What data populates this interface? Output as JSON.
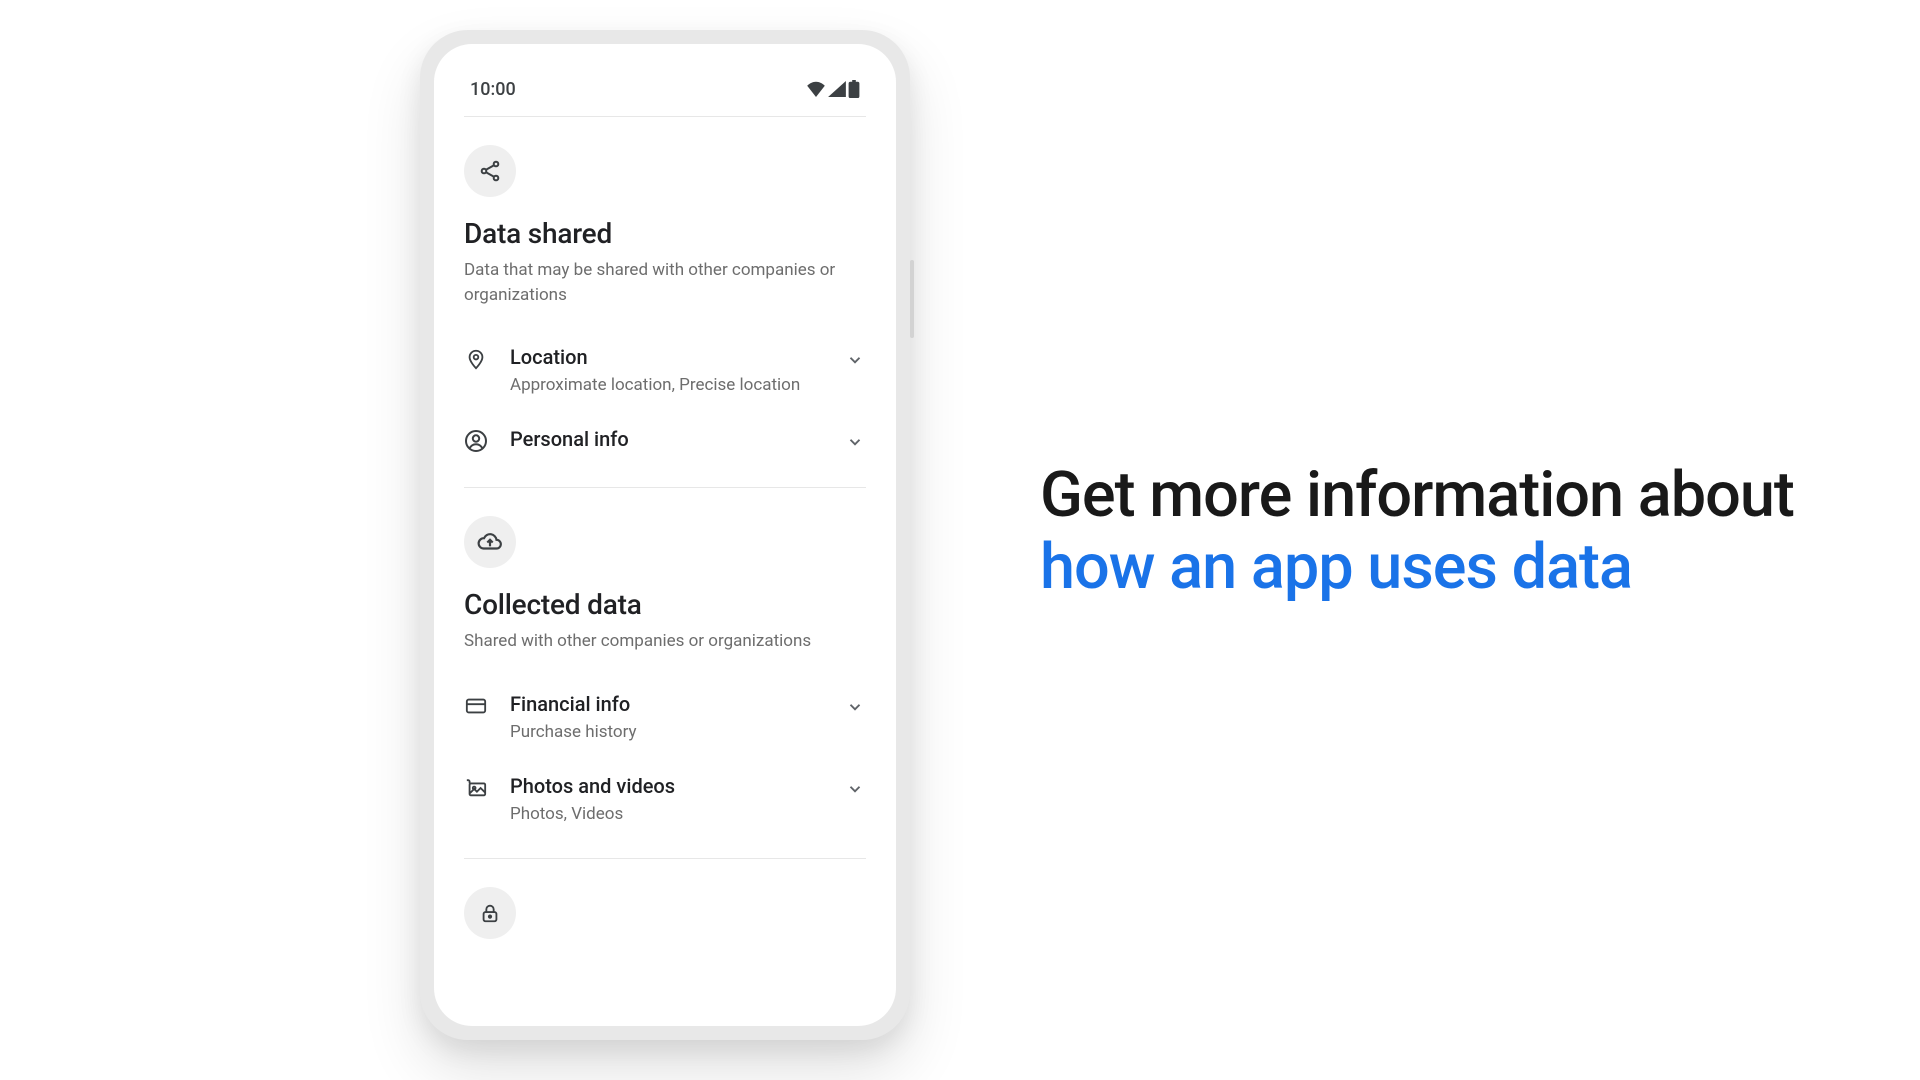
{
  "statusbar": {
    "time": "10:00"
  },
  "sections": {
    "shared": {
      "title": "Data shared",
      "subtitle": "Data that may be shared with other companies or organizations",
      "items": [
        {
          "title": "Location",
          "detail": "Approximate location, Precise location"
        },
        {
          "title": "Personal info",
          "detail": ""
        }
      ]
    },
    "collected": {
      "title": "Collected data",
      "subtitle": "Shared with other companies or organizations",
      "items": [
        {
          "title": "Financial info",
          "detail": "Purchase history"
        },
        {
          "title": "Photos and videos",
          "detail": "Photos, Videos"
        }
      ]
    }
  },
  "headline": {
    "line1": "Get more information about",
    "line2": "how an app uses data"
  }
}
